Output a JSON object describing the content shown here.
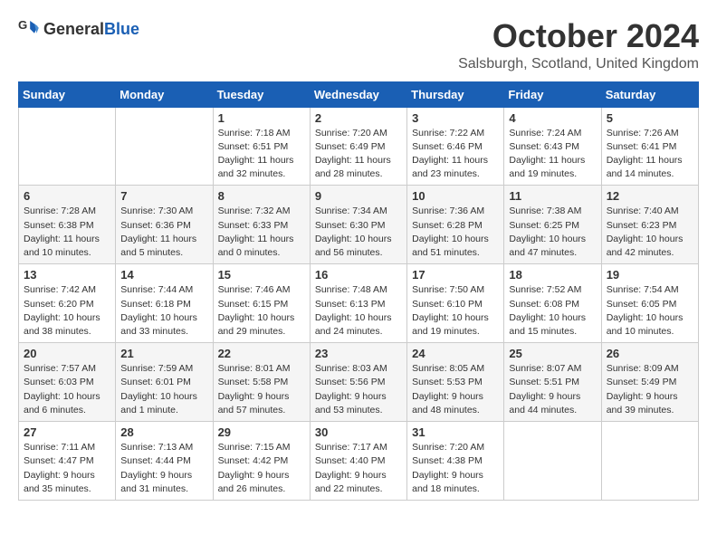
{
  "logo": {
    "general": "General",
    "blue": "Blue"
  },
  "header": {
    "month": "October 2024",
    "location": "Salsburgh, Scotland, United Kingdom"
  },
  "days_of_week": [
    "Sunday",
    "Monday",
    "Tuesday",
    "Wednesday",
    "Thursday",
    "Friday",
    "Saturday"
  ],
  "weeks": [
    [
      {
        "day": "",
        "info": ""
      },
      {
        "day": "",
        "info": ""
      },
      {
        "day": "1",
        "info": "Sunrise: 7:18 AM\nSunset: 6:51 PM\nDaylight: 11 hours and 32 minutes."
      },
      {
        "day": "2",
        "info": "Sunrise: 7:20 AM\nSunset: 6:49 PM\nDaylight: 11 hours and 28 minutes."
      },
      {
        "day": "3",
        "info": "Sunrise: 7:22 AM\nSunset: 6:46 PM\nDaylight: 11 hours and 23 minutes."
      },
      {
        "day": "4",
        "info": "Sunrise: 7:24 AM\nSunset: 6:43 PM\nDaylight: 11 hours and 19 minutes."
      },
      {
        "day": "5",
        "info": "Sunrise: 7:26 AM\nSunset: 6:41 PM\nDaylight: 11 hours and 14 minutes."
      }
    ],
    [
      {
        "day": "6",
        "info": "Sunrise: 7:28 AM\nSunset: 6:38 PM\nDaylight: 11 hours and 10 minutes."
      },
      {
        "day": "7",
        "info": "Sunrise: 7:30 AM\nSunset: 6:36 PM\nDaylight: 11 hours and 5 minutes."
      },
      {
        "day": "8",
        "info": "Sunrise: 7:32 AM\nSunset: 6:33 PM\nDaylight: 11 hours and 0 minutes."
      },
      {
        "day": "9",
        "info": "Sunrise: 7:34 AM\nSunset: 6:30 PM\nDaylight: 10 hours and 56 minutes."
      },
      {
        "day": "10",
        "info": "Sunrise: 7:36 AM\nSunset: 6:28 PM\nDaylight: 10 hours and 51 minutes."
      },
      {
        "day": "11",
        "info": "Sunrise: 7:38 AM\nSunset: 6:25 PM\nDaylight: 10 hours and 47 minutes."
      },
      {
        "day": "12",
        "info": "Sunrise: 7:40 AM\nSunset: 6:23 PM\nDaylight: 10 hours and 42 minutes."
      }
    ],
    [
      {
        "day": "13",
        "info": "Sunrise: 7:42 AM\nSunset: 6:20 PM\nDaylight: 10 hours and 38 minutes."
      },
      {
        "day": "14",
        "info": "Sunrise: 7:44 AM\nSunset: 6:18 PM\nDaylight: 10 hours and 33 minutes."
      },
      {
        "day": "15",
        "info": "Sunrise: 7:46 AM\nSunset: 6:15 PM\nDaylight: 10 hours and 29 minutes."
      },
      {
        "day": "16",
        "info": "Sunrise: 7:48 AM\nSunset: 6:13 PM\nDaylight: 10 hours and 24 minutes."
      },
      {
        "day": "17",
        "info": "Sunrise: 7:50 AM\nSunset: 6:10 PM\nDaylight: 10 hours and 19 minutes."
      },
      {
        "day": "18",
        "info": "Sunrise: 7:52 AM\nSunset: 6:08 PM\nDaylight: 10 hours and 15 minutes."
      },
      {
        "day": "19",
        "info": "Sunrise: 7:54 AM\nSunset: 6:05 PM\nDaylight: 10 hours and 10 minutes."
      }
    ],
    [
      {
        "day": "20",
        "info": "Sunrise: 7:57 AM\nSunset: 6:03 PM\nDaylight: 10 hours and 6 minutes."
      },
      {
        "day": "21",
        "info": "Sunrise: 7:59 AM\nSunset: 6:01 PM\nDaylight: 10 hours and 1 minute."
      },
      {
        "day": "22",
        "info": "Sunrise: 8:01 AM\nSunset: 5:58 PM\nDaylight: 9 hours and 57 minutes."
      },
      {
        "day": "23",
        "info": "Sunrise: 8:03 AM\nSunset: 5:56 PM\nDaylight: 9 hours and 53 minutes."
      },
      {
        "day": "24",
        "info": "Sunrise: 8:05 AM\nSunset: 5:53 PM\nDaylight: 9 hours and 48 minutes."
      },
      {
        "day": "25",
        "info": "Sunrise: 8:07 AM\nSunset: 5:51 PM\nDaylight: 9 hours and 44 minutes."
      },
      {
        "day": "26",
        "info": "Sunrise: 8:09 AM\nSunset: 5:49 PM\nDaylight: 9 hours and 39 minutes."
      }
    ],
    [
      {
        "day": "27",
        "info": "Sunrise: 7:11 AM\nSunset: 4:47 PM\nDaylight: 9 hours and 35 minutes."
      },
      {
        "day": "28",
        "info": "Sunrise: 7:13 AM\nSunset: 4:44 PM\nDaylight: 9 hours and 31 minutes."
      },
      {
        "day": "29",
        "info": "Sunrise: 7:15 AM\nSunset: 4:42 PM\nDaylight: 9 hours and 26 minutes."
      },
      {
        "day": "30",
        "info": "Sunrise: 7:17 AM\nSunset: 4:40 PM\nDaylight: 9 hours and 22 minutes."
      },
      {
        "day": "31",
        "info": "Sunrise: 7:20 AM\nSunset: 4:38 PM\nDaylight: 9 hours and 18 minutes."
      },
      {
        "day": "",
        "info": ""
      },
      {
        "day": "",
        "info": ""
      }
    ]
  ]
}
